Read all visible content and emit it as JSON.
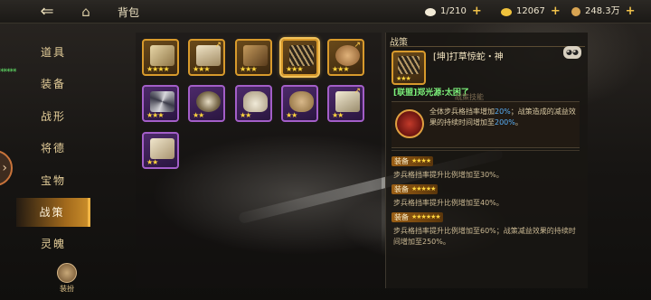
{
  "topbar": {
    "title": "背包",
    "resources": [
      {
        "value": "1/210",
        "color": "#f2ead6",
        "icon": "silver-ingot-icon"
      },
      {
        "value": "12067",
        "color": "#f0c23c",
        "icon": "gold-ingot-icon"
      },
      {
        "value": "248.3万",
        "color": "#d8a452",
        "icon": "copper-coin-icon"
      }
    ]
  },
  "sidebar": {
    "tabs": [
      "道具",
      "装备",
      "战形",
      "将德",
      "宝物",
      "战策",
      "灵魄"
    ],
    "active_index": 5,
    "green_text": "*****",
    "bottom_button": "装扮"
  },
  "panel": {
    "header": "战策",
    "items": [
      {
        "stars": "★★★★",
        "frame": "gold",
        "icon": "scroll-icon"
      },
      {
        "stars": "★★★",
        "frame": "gold",
        "icon": "rolled-scroll-icon"
      },
      {
        "stars": "★★★",
        "frame": "gold",
        "icon": "map-scroll-icon"
      },
      {
        "stars": "★★★",
        "frame": "gold",
        "icon": "bamboo-slips-icon"
      },
      {
        "stars": "★★★",
        "frame": "gold",
        "icon": "round-seal-icon"
      },
      {
        "stars": "★★★",
        "frame": "purple",
        "icon": "folding-fan-icon"
      },
      {
        "stars": "★★",
        "frame": "purple",
        "icon": "bronze-mirror-icon"
      },
      {
        "stars": "★★",
        "frame": "purple",
        "icon": "vase-icon"
      },
      {
        "stars": "★★",
        "frame": "purple",
        "icon": "drum-icon"
      },
      {
        "stars": "★★",
        "frame": "purple",
        "icon": "tied-scroll-icon"
      },
      {
        "stars": "★★",
        "frame": "purple",
        "icon": "paper-scroll-icon"
      }
    ]
  },
  "detail": {
    "item_name": "[坤]打草惊蛇・神",
    "icon_stars": "★★★",
    "league": "[联盟]郑光源:太困了",
    "skill_header": "战策技能",
    "skill": {
      "part1": "全体步兵格挡率增加",
      "v1": "20%",
      "part2": "；战策造成的减益效果的持续时间增加至",
      "v2": "200%",
      "part3": "。"
    },
    "equips": [
      {
        "label": "装备",
        "stars": "★★★★",
        "text": "步兵格挡率提升比例增加至30%。"
      },
      {
        "label": "装备",
        "stars": "★★★★★",
        "text": "步兵格挡率提升比例增加至40%。"
      },
      {
        "label": "装备",
        "stars": "★★★★★★",
        "text": "步兵格挡率提升比例增加至60%；战策减益效果的持续时间增加至250%。"
      }
    ]
  }
}
